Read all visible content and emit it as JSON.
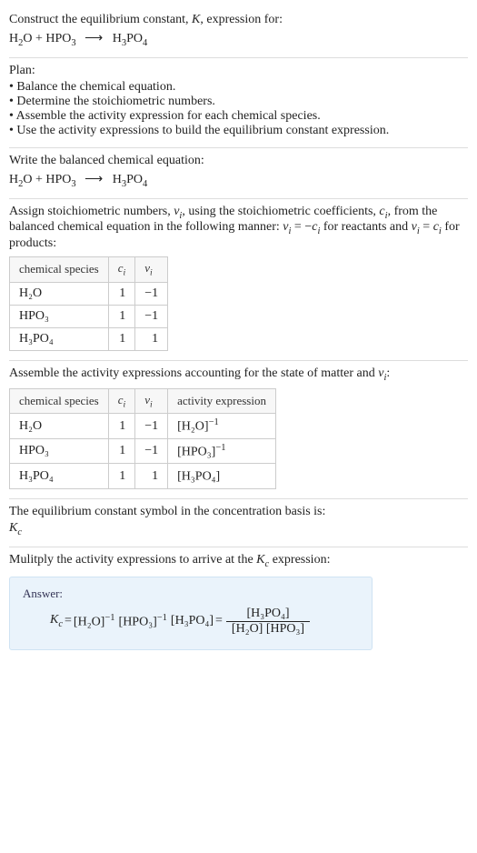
{
  "intro": {
    "line1_pre": "Construct the equilibrium constant, ",
    "K": "K",
    "line1_post": ", expression for:"
  },
  "reaction": {
    "r1": "H",
    "r1s": "2",
    "r1b": "O",
    "plus1": " + ",
    "r2": "HPO",
    "r2s": "3",
    "arrow": "⟶",
    "p1": "H",
    "p1s": "3",
    "p1b": "PO",
    "p1s2": "4"
  },
  "plan": {
    "title": "Plan:",
    "items": [
      "Balance the chemical equation.",
      "Determine the stoichiometric numbers.",
      "Assemble the activity expression for each chemical species.",
      "Use the activity expressions to build the equilibrium constant expression."
    ]
  },
  "balanced_label": "Write the balanced chemical equation:",
  "stoich_text": {
    "pre": "Assign stoichiometric numbers, ",
    "nu": "ν",
    "nu_i": "i",
    "mid1": ", using the stoichiometric coefficients, ",
    "c": "c",
    "c_i": "i",
    "mid2": ", from the balanced chemical equation in the following manner: ",
    "eq1_lhs": "ν",
    "eq1_lhs_i": "i",
    "eq1_eq": " = −",
    "eq1_rhs": "c",
    "eq1_rhs_i": "i",
    "mid3": " for reactants and ",
    "eq2_lhs": "ν",
    "eq2_lhs_i": "i",
    "eq2_eq": " = ",
    "eq2_rhs": "c",
    "eq2_rhs_i": "i",
    "post": " for products:"
  },
  "table1": {
    "h1": "chemical species",
    "h2": "c",
    "h2_i": "i",
    "h3": "ν",
    "h3_i": "i",
    "rows": [
      {
        "sp": "H₂O",
        "c": "1",
        "nu": "−1"
      },
      {
        "sp": "HPO₃",
        "c": "1",
        "nu": "−1"
      },
      {
        "sp": "H₃PO₄",
        "c": "1",
        "nu": "1"
      }
    ]
  },
  "activity_intro": {
    "pre": "Assemble the activity expressions accounting for the state of matter and ",
    "nu": "ν",
    "nu_i": "i",
    "post": ":"
  },
  "table2": {
    "h1": "chemical species",
    "h2": "c",
    "h2_i": "i",
    "h3": "ν",
    "h3_i": "i",
    "h4": "activity expression",
    "rows": [
      {
        "sp": "H₂O",
        "c": "1",
        "nu": "−1",
        "act_base": "[H₂O]",
        "act_exp": "−1"
      },
      {
        "sp": "HPO₃",
        "c": "1",
        "nu": "−1",
        "act_base": "[HPO₃]",
        "act_exp": "−1"
      },
      {
        "sp": "H₃PO₄",
        "c": "1",
        "nu": "1",
        "act_base": "[H₃PO₄]",
        "act_exp": ""
      }
    ]
  },
  "kc_symbol": {
    "line": "The equilibrium constant symbol in the concentration basis is:",
    "K": "K",
    "K_c": "c"
  },
  "multiply": {
    "pre": "Mulitply the activity expressions to arrive at the ",
    "K": "K",
    "K_c": "c",
    "post": " expression:"
  },
  "answer": {
    "label": "Answer:",
    "K": "K",
    "K_c": "c",
    "eq": " = ",
    "t1_base": "[H₂O]",
    "t1_exp": "−1",
    "sp": " ",
    "t2_base": "[HPO₃]",
    "t2_exp": "−1",
    "t3_base": "[H₃PO₄]",
    "eq2": " = ",
    "num": "[H₃PO₄]",
    "den1": "[H₂O] ",
    "den2": "[HPO₃]"
  },
  "chart_data": {
    "type": "table",
    "tables": [
      {
        "title": "stoichiometric numbers",
        "columns": [
          "chemical species",
          "c_i",
          "ν_i"
        ],
        "rows": [
          [
            "H2O",
            1,
            -1
          ],
          [
            "HPO3",
            1,
            -1
          ],
          [
            "H3PO4",
            1,
            1
          ]
        ]
      },
      {
        "title": "activity expressions",
        "columns": [
          "chemical species",
          "c_i",
          "ν_i",
          "activity expression"
        ],
        "rows": [
          [
            "H2O",
            1,
            -1,
            "[H2O]^-1"
          ],
          [
            "HPO3",
            1,
            -1,
            "[HPO3]^-1"
          ],
          [
            "H3PO4",
            1,
            1,
            "[H3PO4]"
          ]
        ]
      }
    ]
  }
}
